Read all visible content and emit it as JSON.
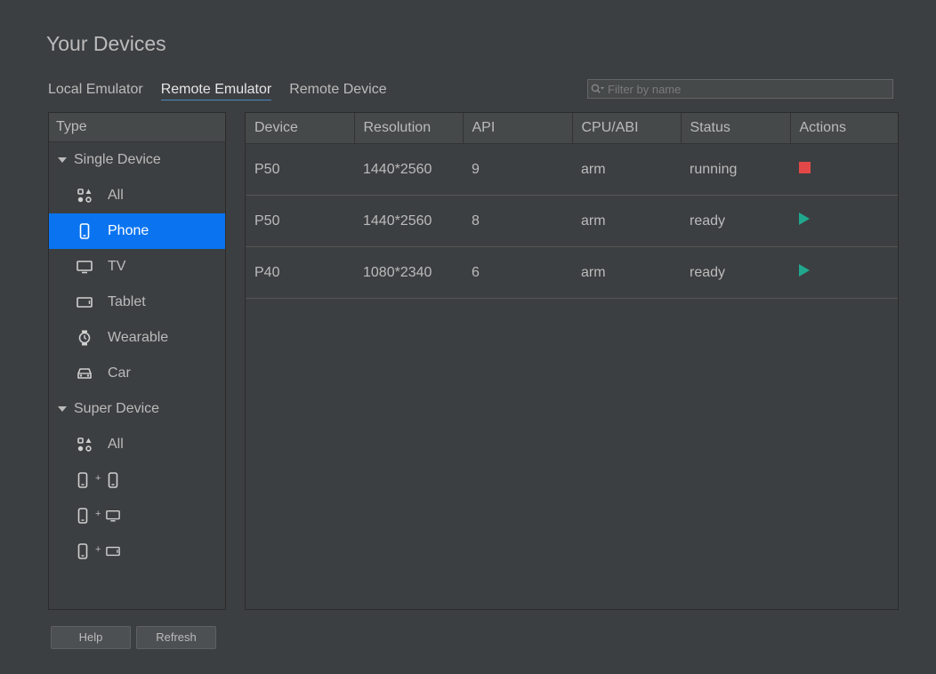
{
  "page": {
    "title": "Your Devices"
  },
  "tabs": [
    {
      "label": "Local Emulator",
      "active": false
    },
    {
      "label": "Remote Emulator",
      "active": true
    },
    {
      "label": "Remote Device",
      "active": false
    }
  ],
  "filter": {
    "placeholder": "Filter by name",
    "value": ""
  },
  "type_panel": {
    "header": "Type",
    "single_device": {
      "label": "Single Device",
      "items": [
        {
          "label": "All",
          "icon": "grid-shapes-icon"
        },
        {
          "label": "Phone",
          "icon": "phone-icon",
          "selected": true
        },
        {
          "label": "TV",
          "icon": "tv-icon"
        },
        {
          "label": "Tablet",
          "icon": "tablet-icon"
        },
        {
          "label": "Wearable",
          "icon": "watch-icon"
        },
        {
          "label": "Car",
          "icon": "car-icon"
        }
      ]
    },
    "super_device": {
      "label": "Super Device",
      "all_label": "All",
      "combos": [
        {
          "icons": [
            "phone-icon",
            "phone-icon"
          ],
          "joiner": "+"
        },
        {
          "icons": [
            "phone-icon",
            "tv-icon"
          ],
          "joiner": "+"
        },
        {
          "icons": [
            "phone-icon",
            "tablet-icon"
          ],
          "joiner": "+"
        }
      ]
    }
  },
  "table": {
    "columns": [
      "Device",
      "Resolution",
      "API",
      "CPU/ABI",
      "Status",
      "Actions"
    ],
    "rows": [
      {
        "device": "P50",
        "resolution": "1440*2560",
        "api": "9",
        "cpu": "arm",
        "status": "running",
        "action": "stop"
      },
      {
        "device": "P50",
        "resolution": "1440*2560",
        "api": "8",
        "cpu": "arm",
        "status": "ready",
        "action": "play"
      },
      {
        "device": "P40",
        "resolution": "1080*2340",
        "api": "6",
        "cpu": "arm",
        "status": "ready",
        "action": "play"
      }
    ]
  },
  "buttons": {
    "help": "Help",
    "refresh": "Refresh"
  },
  "colors": {
    "background": "#3c3f41",
    "selected": "#0a74f0",
    "stop": "#e34848",
    "play": "#1fa88e",
    "tab_underline": "#4a88c7"
  }
}
